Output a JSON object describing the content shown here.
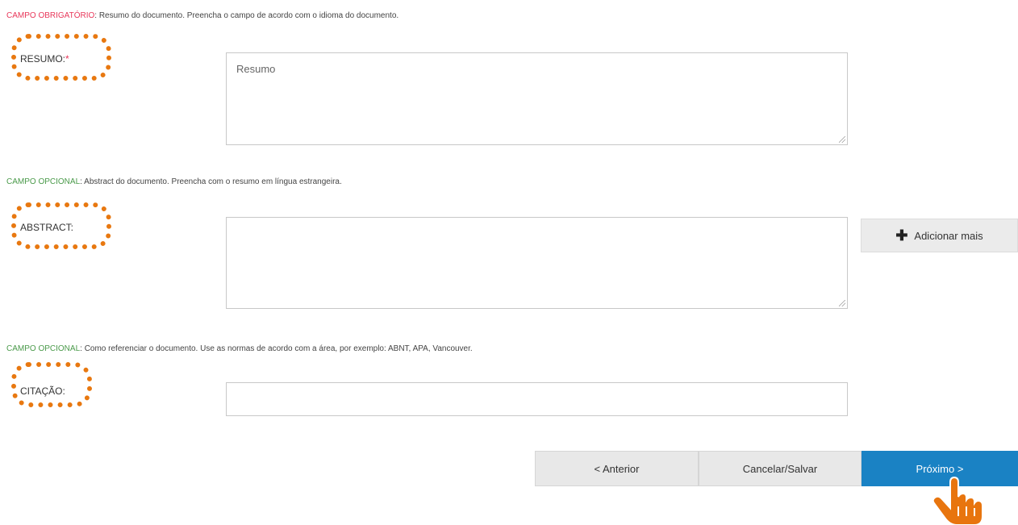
{
  "resumo": {
    "hint_tag": "CAMPO OBRIGATÓRIO",
    "hint_text": ": Resumo do documento. Preencha o campo de acordo com o idioma do documento.",
    "label": "RESUMO:",
    "required_mark": "*",
    "placeholder": "Resumo",
    "value": ""
  },
  "abstract": {
    "hint_tag": "CAMPO OPCIONAL",
    "hint_text": ": Abstract do documento. Preencha com o resumo em língua estrangeira.",
    "label": "ABSTRACT:",
    "value": "",
    "add_more_label": "Adicionar mais"
  },
  "citacao": {
    "hint_tag": "CAMPO OPCIONAL",
    "hint_text": ": Como referenciar o documento. Use as normas de acordo com a área, por exemplo: ABNT, APA, Vancouver.",
    "label": "CITAÇÃO:",
    "value": ""
  },
  "navigation": {
    "previous_label": "< Anterior",
    "cancel_label": "Cancelar/Salvar",
    "next_label": "Próximo >"
  },
  "colors": {
    "required": "#e8375a",
    "optional": "#4a9a4a",
    "highlight": "#e87810",
    "primary": "#1a82c4"
  },
  "icons": {
    "add": "plus-icon",
    "pointer": "hand-pointer-icon"
  }
}
